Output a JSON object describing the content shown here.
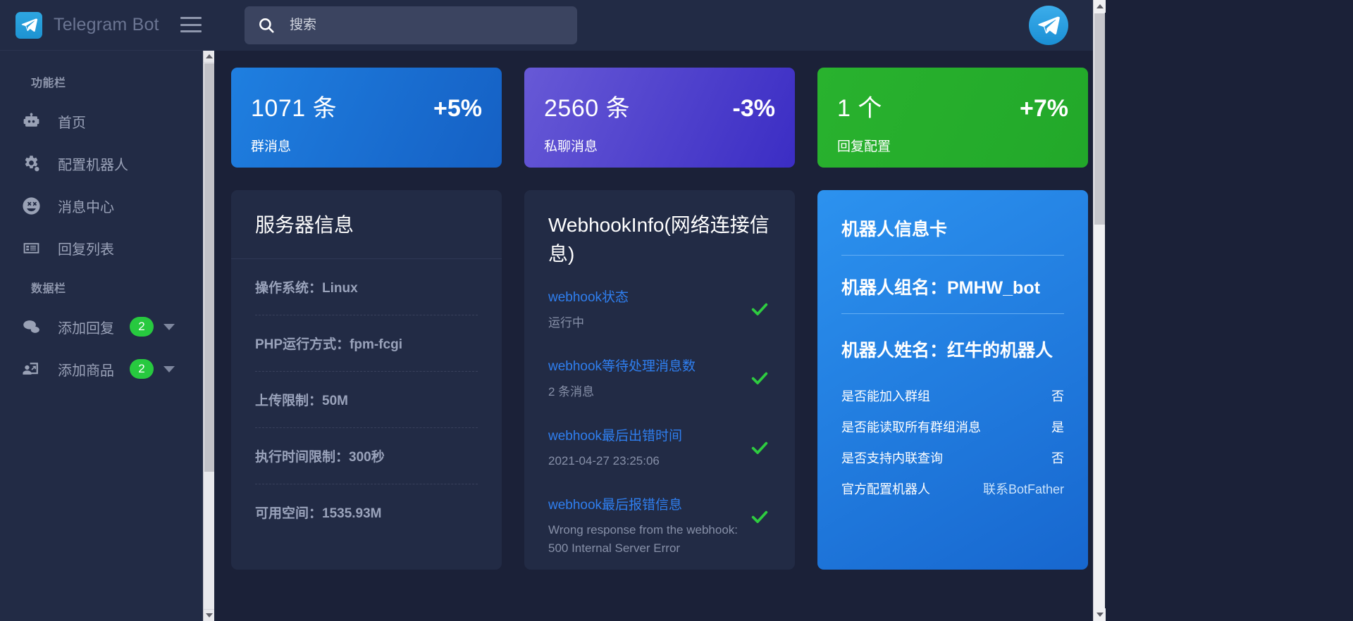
{
  "brand": {
    "title": "Telegram Bot",
    "logo_icon": "telegram-paper-plane-icon",
    "menu_icon": "hamburger-menu-icon"
  },
  "search": {
    "placeholder": "搜索",
    "value": "",
    "icon": "search-icon"
  },
  "header": {
    "avatar_icon": "telegram-avatar-icon"
  },
  "sidebar": {
    "sections": [
      {
        "title": "功能栏",
        "items": [
          {
            "label": "首页",
            "icon": "robot-icon"
          },
          {
            "label": "配置机器人",
            "icon": "gears-icon"
          },
          {
            "label": "消息中心",
            "icon": "smiley-face-icon"
          },
          {
            "label": "回复列表",
            "icon": "list-card-icon"
          }
        ]
      },
      {
        "title": "数据栏",
        "items": [
          {
            "label": "添加回复",
            "icon": "chat-bubbles-icon",
            "badge": "2",
            "caret": true
          },
          {
            "label": "添加商品",
            "icon": "user-share-icon",
            "badge": "2",
            "caret": true
          }
        ]
      }
    ]
  },
  "stats": [
    {
      "value": "1071 条",
      "pct": "+5%",
      "label": "群消息",
      "color": "#1f7fe0",
      "theme": "stat-blue"
    },
    {
      "value": "2560 条",
      "pct": "-3%",
      "label": "私聊消息",
      "color": "#6759d6",
      "theme": "stat-purple"
    },
    {
      "value": "1 个",
      "pct": "+7%",
      "label": "回复配置",
      "color": "#29b22e",
      "theme": "stat-green"
    }
  ],
  "server_panel": {
    "title": "服务器信息",
    "rows": [
      "操作系统：Linux",
      "PHP运行方式：fpm-fcgi",
      "上传限制：50M",
      "执行时间限制：300秒",
      "可用空间：1535.93M"
    ]
  },
  "webhook_panel": {
    "title": "WebhookInfo(网络连接信息)",
    "rows": [
      {
        "name": "webhook状态",
        "sub": "运行中",
        "status_icon": "check-icon",
        "status_color": "#2ecc40"
      },
      {
        "name": "webhook等待处理消息数",
        "sub": "2 条消息",
        "status_icon": "check-icon",
        "status_color": "#2ecc40"
      },
      {
        "name": "webhook最后出错时间",
        "sub": "2021-04-27 23:25:06",
        "status_icon": "check-icon",
        "status_color": "#2ecc40"
      },
      {
        "name": "webhook最后报错信息",
        "sub": "Wrong response from the webhook: 500 Internal Server Error",
        "status_icon": "check-icon",
        "status_color": "#2ecc40"
      }
    ]
  },
  "bot_card": {
    "heading": "机器人信息卡",
    "group_name": "机器人组名：PMHW_bot",
    "bot_name": "机器人姓名：红牛的机器人",
    "lines": [
      {
        "key": "是否能加入群组",
        "value": "否"
      },
      {
        "key": "是否能读取所有群组消息",
        "value": "是"
      },
      {
        "key": "是否支持内联查询",
        "value": "否"
      },
      {
        "key": "官方配置机器人",
        "value": "联系BotFather",
        "link": true
      }
    ]
  }
}
